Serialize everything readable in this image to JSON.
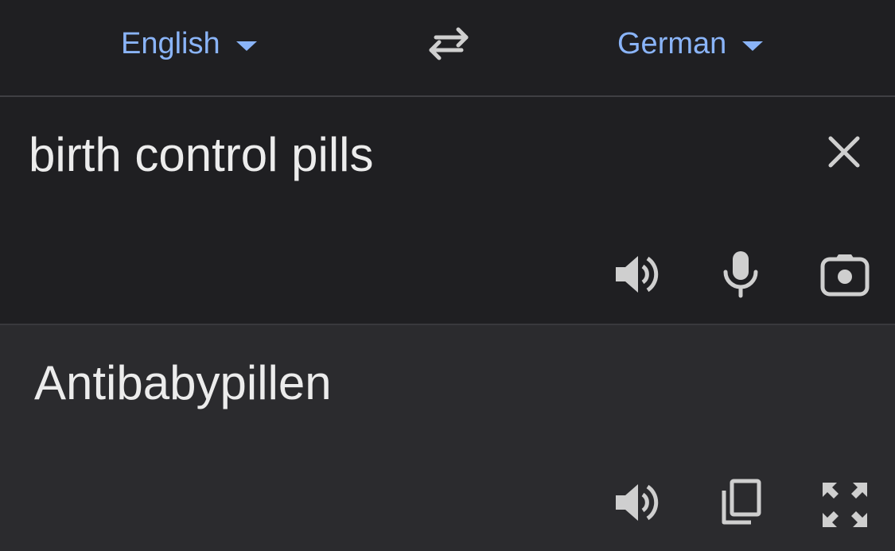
{
  "languages": {
    "source": "English",
    "target": "German"
  },
  "input": {
    "text": "birth control pills"
  },
  "output": {
    "text": "Antibabypillen"
  },
  "icons": {
    "swap": "swap-arrows-icon",
    "clear": "close-icon",
    "listen_source": "speaker-icon",
    "mic": "microphone-icon",
    "camera": "camera-icon",
    "listen_target": "speaker-icon",
    "copy": "copy-icon",
    "fullscreen": "fullscreen-icon"
  },
  "colors": {
    "accent": "#8ab4f8",
    "text": "#ececec",
    "icon": "#cfcfcf",
    "background": "#1f1f22",
    "output_background": "#2b2b2e"
  }
}
